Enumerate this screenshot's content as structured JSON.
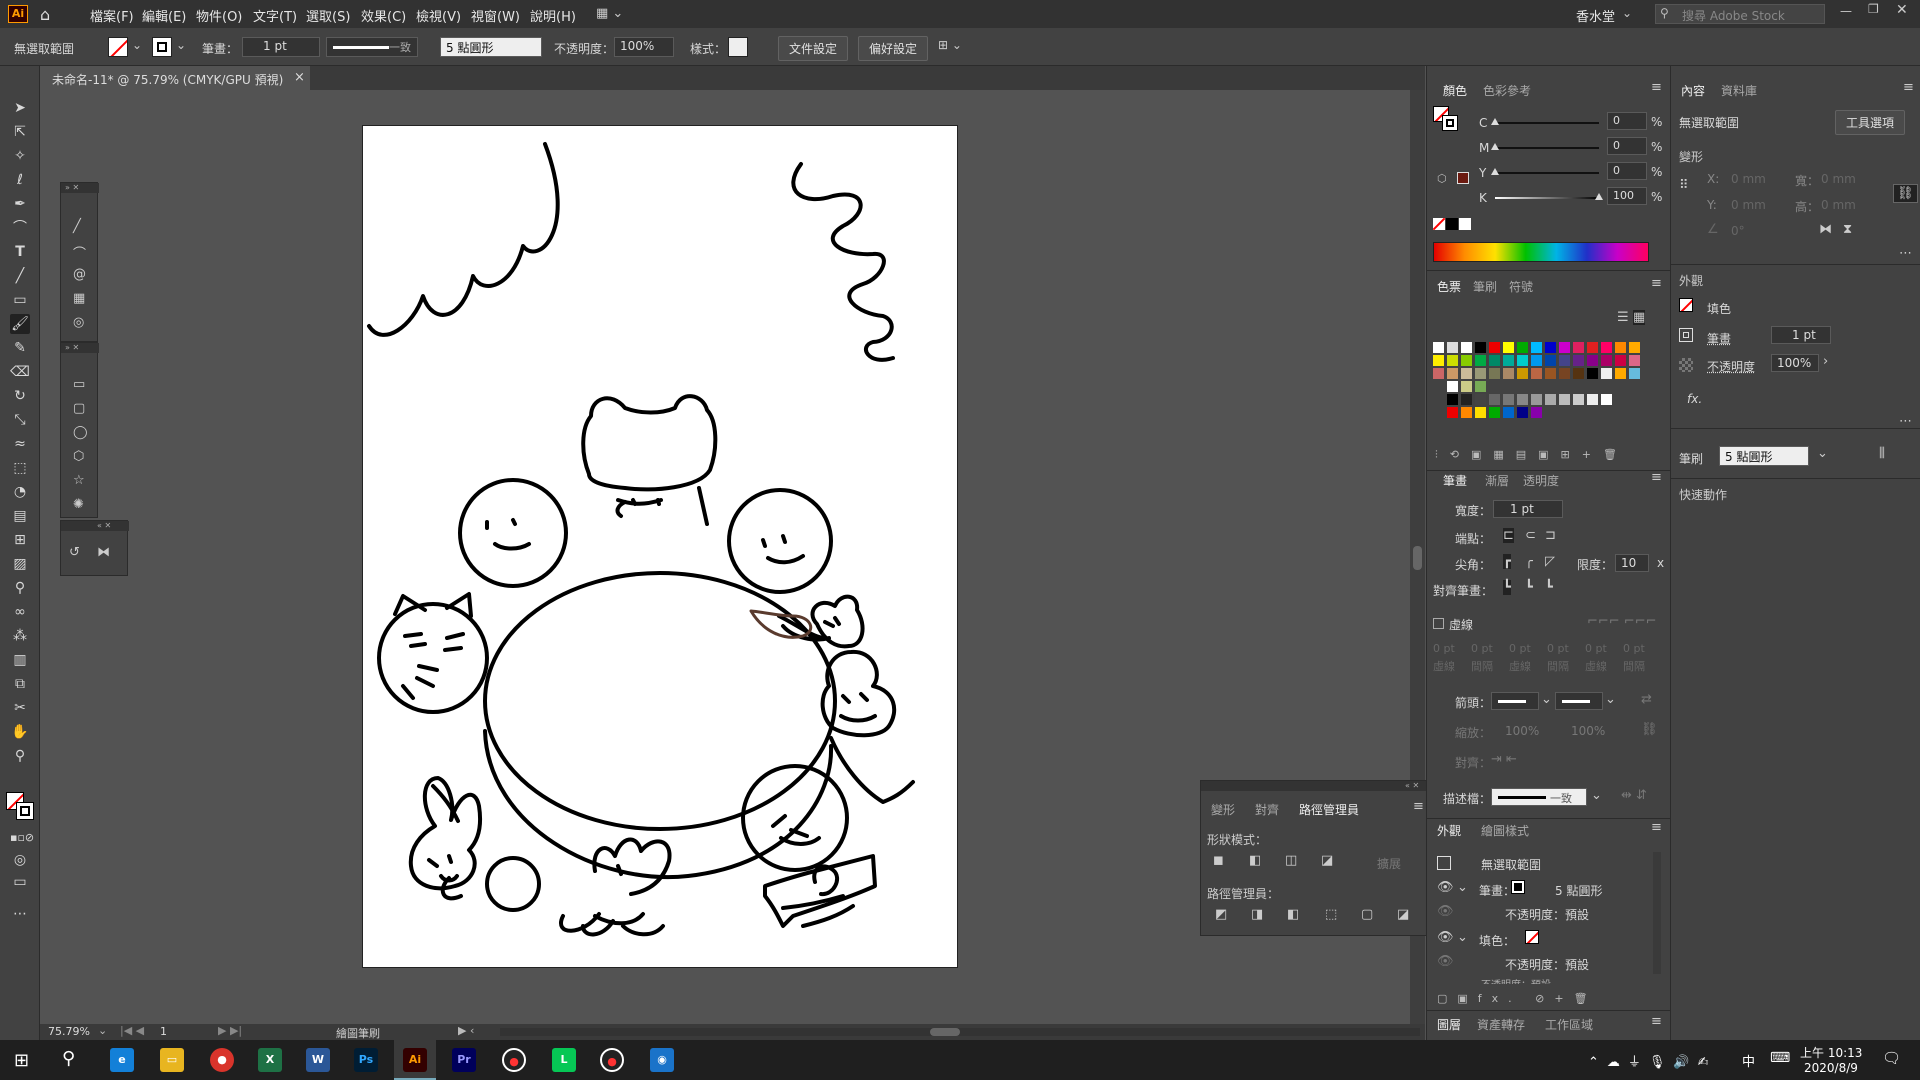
{
  "app": {
    "logo": "Ai",
    "menus": [
      "檔案(F)",
      "編輯(E)",
      "物件(O)",
      "文字(T)",
      "選取(S)",
      "效果(C)",
      "檢視(V)",
      "視窗(W)",
      "說明(H)"
    ],
    "workspace": "香水堂",
    "search_placeholder": "搜尋 Adobe Stock"
  },
  "control": {
    "selection": "無選取範圍",
    "stroke_label": "筆畫：",
    "stroke_value": "1 pt",
    "profile": "一致",
    "brush": "5 點圓形",
    "opacity_label": "不透明度：",
    "opacity_value": "100%",
    "style_label": "樣式：",
    "doc_setup": "文件設定",
    "prefs": "偏好設定"
  },
  "document": {
    "tab": "未命名-11* @ 75.79% (CMYK/GPU 預視)",
    "close": "×"
  },
  "status": {
    "zoom": "75.79%",
    "page": "1",
    "tool": "繪圖筆刷"
  },
  "color_panel": {
    "tabs": [
      "顏色",
      "色彩參考"
    ],
    "channels": [
      {
        "name": "C",
        "value": "0",
        "unit": "%"
      },
      {
        "name": "M",
        "value": "0",
        "unit": "%"
      },
      {
        "name": "Y",
        "value": "0",
        "unit": "%"
      },
      {
        "name": "K",
        "value": "100",
        "unit": "%"
      }
    ]
  },
  "swatch_panel": {
    "tabs": [
      "色票",
      "筆刷",
      "符號"
    ]
  },
  "stroke_panel": {
    "tabs": [
      "筆畫",
      "漸層",
      "透明度"
    ],
    "width_label": "寬度：",
    "width_value": "1 pt",
    "cap_label": "端點：",
    "corner_label": "尖角：",
    "limit_label": "限度：",
    "limit_value": "10",
    "limit_unit": "x",
    "align_label": "對齊筆畫：",
    "dashed_label": "虛線",
    "dash_values": [
      "0 pt",
      "0 pt",
      "0 pt",
      "0 pt",
      "0 pt",
      "0 pt"
    ],
    "dash_labels": [
      "虛線",
      "間隔",
      "虛線",
      "間隔",
      "虛線",
      "間隔"
    ],
    "arrow_label": "箭頭：",
    "scale_label": "縮放：",
    "scale1": "100%",
    "scale2": "100%",
    "align2_label": "對齊：",
    "profile_label": "描述檔：",
    "profile_value": "一致"
  },
  "appearance_panel": {
    "tabs": [
      "外觀",
      "繪圖樣式"
    ],
    "title": "無選取範圍",
    "stroke_row": "筆畫：",
    "stroke_brush": "5 點圓形",
    "opacity1": "不透明度：預設",
    "fill_row": "填色：",
    "opacity2": "不透明度：預設",
    "cut": "不透明度：預設"
  },
  "layers_panel": {
    "tabs": [
      "圖層",
      "資產轉存",
      "工作區域"
    ]
  },
  "pathfinder_panel": {
    "tabs": [
      "變形",
      "對齊",
      "路徑管理員"
    ],
    "shape_modes": "形狀模式：",
    "expand": "擴展",
    "pathfinders": "路徑管理員："
  },
  "properties_panel": {
    "tabs": [
      "內容",
      "資料庫"
    ],
    "selection": "無選取範圍",
    "tool_options": "工具選項",
    "transform": "變形",
    "x_label": "X:",
    "x_value": "0 mm",
    "w_label": "寬：",
    "w_value": "0 mm",
    "y_label": "Y:",
    "y_value": "0 mm",
    "h_label": "高：",
    "h_value": "0 mm",
    "angle": "0°",
    "appearance": "外觀",
    "fill": "填色",
    "stroke": "筆畫",
    "stroke_value": "1 pt",
    "opacity": "不透明度",
    "opacity_value": "100%",
    "fx": "fx.",
    "brush_label": "筆刷",
    "brush_value": "5 點圓形",
    "quick_actions": "快速動作"
  },
  "taskbar": {
    "time": "上午 10:13",
    "date": "2020/8/9",
    "ime": "中"
  },
  "colors": {
    "accent_red": "#ff0000",
    "bg": "#535353"
  }
}
